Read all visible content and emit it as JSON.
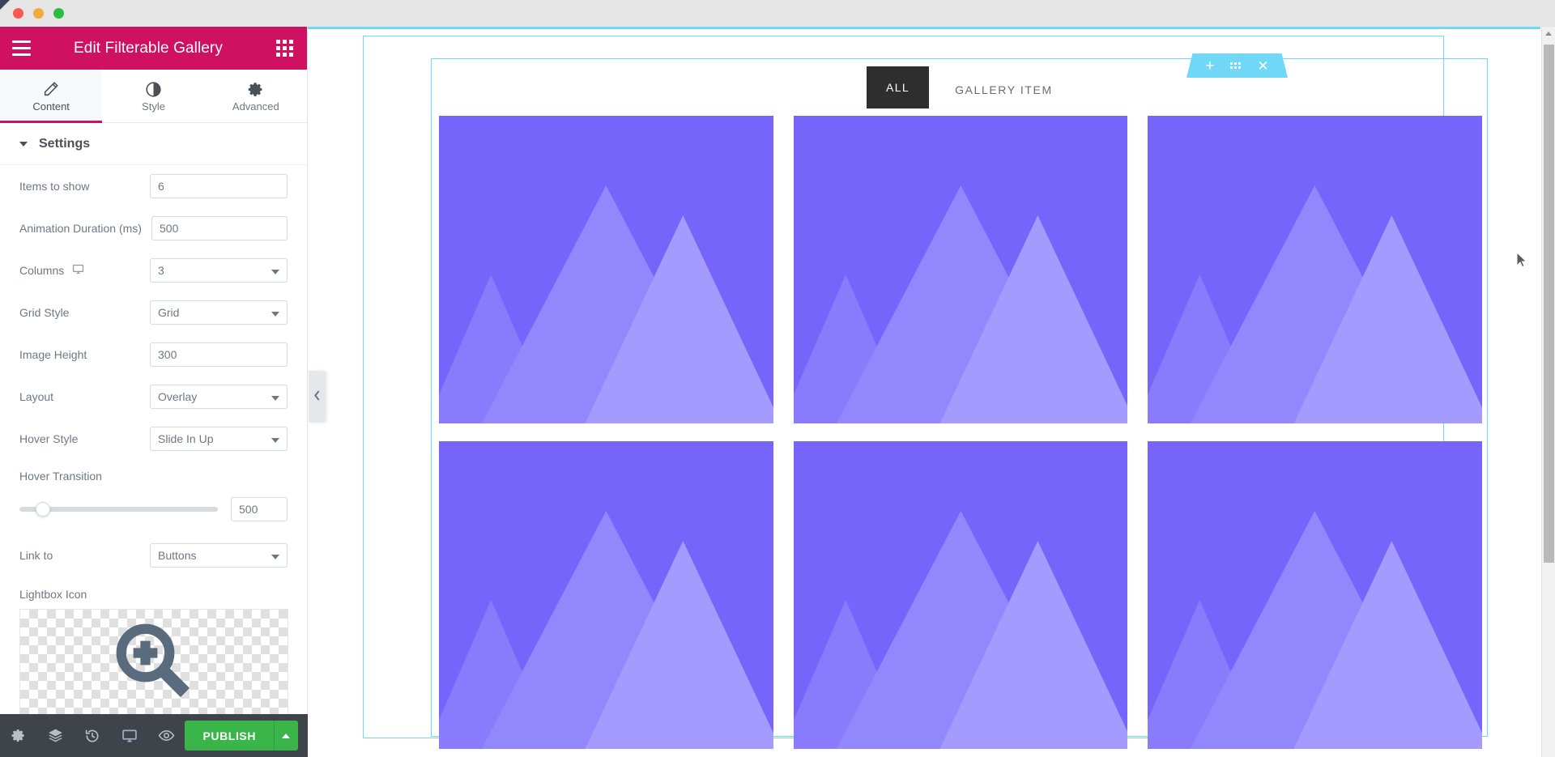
{
  "window": {
    "traffic_lights": [
      "close",
      "minimize",
      "maximize"
    ]
  },
  "panel": {
    "title": "Edit Filterable Gallery",
    "header_accent": "#d01060",
    "menu_icon": "hamburger-icon",
    "grid_icon": "widgets-grid-icon",
    "tabs": [
      {
        "label": "Content",
        "icon": "pencil-icon",
        "active": true
      },
      {
        "label": "Style",
        "icon": "contrast-icon",
        "active": false
      },
      {
        "label": "Advanced",
        "icon": "gear-icon",
        "active": false
      }
    ],
    "section": {
      "title": "Settings",
      "expanded": true
    },
    "controls": [
      {
        "name": "items-to-show",
        "label": "Items to show",
        "type": "number",
        "value": "6"
      },
      {
        "name": "animation-duration",
        "label": "Animation Duration (ms)",
        "type": "number",
        "value": "500"
      },
      {
        "name": "columns",
        "label": "Columns",
        "type": "select",
        "value": "3",
        "device_icon": "desktop-icon"
      },
      {
        "name": "grid-style",
        "label": "Grid Style",
        "type": "select",
        "value": "Grid"
      },
      {
        "name": "image-height",
        "label": "Image Height",
        "type": "number",
        "value": "300"
      },
      {
        "name": "layout",
        "label": "Layout",
        "type": "select",
        "value": "Overlay"
      },
      {
        "name": "hover-style",
        "label": "Hover Style",
        "type": "select",
        "value": "Slide In Up"
      }
    ],
    "hover_transition": {
      "label": "Hover Transition",
      "value": "500",
      "slider_percent": 12
    },
    "link_to": {
      "label": "Link to",
      "value": "Buttons"
    },
    "lightbox_icon": {
      "label": "Lightbox Icon",
      "icon": "magnifier-plus-icon"
    },
    "footer": {
      "buttons": [
        {
          "name": "settings-button",
          "icon": "gear-icon"
        },
        {
          "name": "navigator-button",
          "icon": "layers-icon"
        },
        {
          "name": "history-button",
          "icon": "history-clock-icon"
        },
        {
          "name": "responsive-mode-button",
          "icon": "desktop-icon"
        },
        {
          "name": "preview-button",
          "icon": "eye-icon"
        }
      ],
      "publish_label": "PUBLISH",
      "publish_color": "#39b54a",
      "publish_arrow_icon": "caret-up-icon"
    },
    "collapse_handle_icon": "chevron-left-icon"
  },
  "canvas": {
    "section_toolbar": {
      "add_icon": "plus-icon",
      "handle_icon": "drag-handle-icon",
      "close_icon": "close-icon",
      "accent": "#71d7f7"
    },
    "filters": [
      {
        "label": "ALL",
        "active": true
      },
      {
        "label": "GALLERY ITEM",
        "active": false
      }
    ],
    "gallery": {
      "item_count": 6,
      "columns": 3,
      "placeholder_icon": "mountain-image-placeholder",
      "tile_color": "#7765fb",
      "tile_highlight": "#aba0fd"
    }
  },
  "scrollbar": {
    "up_arrow_icon": "caret-up-icon",
    "down_arrow_icon": "caret-down-icon"
  },
  "cursor": {
    "icon": "mouse-pointer-icon"
  }
}
